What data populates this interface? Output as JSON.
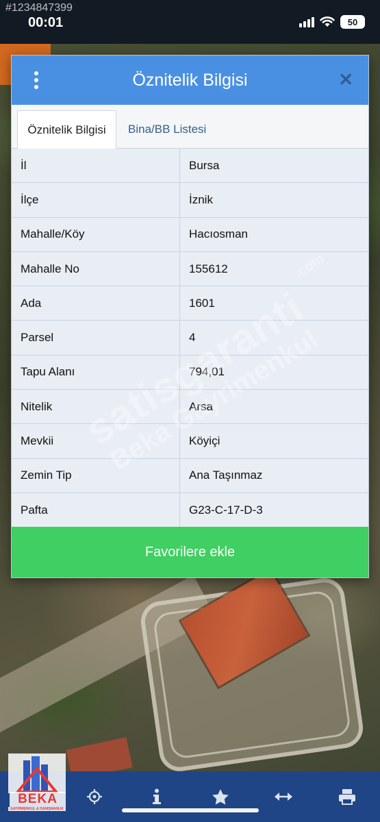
{
  "status_bar": {
    "listing_id": "#1234847399",
    "time": "00:01",
    "battery": "50"
  },
  "modal": {
    "title": "Öznitelik Bilgisi",
    "tabs": [
      {
        "label": "Öznitelik Bilgisi",
        "active": true
      },
      {
        "label": "Bina/BB Listesi",
        "active": false
      }
    ],
    "rows": [
      {
        "key": "İl",
        "value": "Bursa"
      },
      {
        "key": "İlçe",
        "value": "İznik"
      },
      {
        "key": "Mahalle/Köy",
        "value": "Hacıosman"
      },
      {
        "key": "Mahalle No",
        "value": "155612"
      },
      {
        "key": "Ada",
        "value": "1601"
      },
      {
        "key": "Parsel",
        "value": "4"
      },
      {
        "key": "Tapu Alanı",
        "value": "794,01"
      },
      {
        "key": "Nitelik",
        "value": "Arsa"
      },
      {
        "key": "Mevkii",
        "value": "Köyiçi"
      },
      {
        "key": "Zemin Tip",
        "value": "Ana Taşınmaz"
      },
      {
        "key": "Pafta",
        "value": "G23-C-17-D-3"
      }
    ],
    "favorite_button": "Favorilere ekle"
  },
  "watermark": {
    "line1": "satisgaranti",
    "line2": "Beka Gayrimenkul",
    "domain": ".com"
  },
  "logo": {
    "name": "BEKA",
    "subtitle": "GAYRİMENKUL & DANIŞMANLIK"
  },
  "toolbar": {
    "icons": [
      "crosshair-icon",
      "info-icon",
      "star-icon",
      "arrows-horizontal-icon",
      "print-icon"
    ]
  },
  "colors": {
    "header_blue": "#4a90e2",
    "button_green": "#3fcf62",
    "toolbar_navy": "#1f4586"
  }
}
